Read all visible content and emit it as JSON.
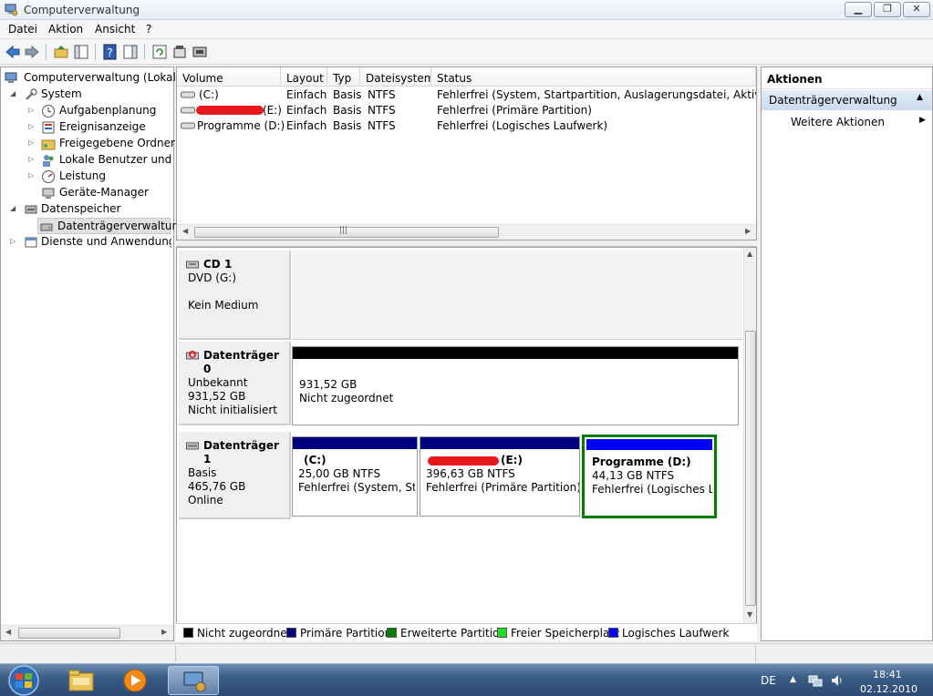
{
  "window": {
    "title": "Computerverwaltung",
    "minimize": "▁",
    "maximize": "❐",
    "close": "✕"
  },
  "menu": [
    "Datei",
    "Aktion",
    "Ansicht",
    "?"
  ],
  "tree": {
    "root": "Computerverwaltung (Lokal)",
    "system": "System",
    "aufgaben": "Aufgabenplanung",
    "ereignis": "Ereignisanzeige",
    "ordner": "Freigegebene Ordner",
    "benutzer": "Lokale Benutzer und Gr",
    "leistung": "Leistung",
    "geraete": "Geräte-Manager",
    "datenspeicher": "Datenspeicher",
    "datentraeger": "Datenträgerverwaltung",
    "dienste": "Dienste und Anwendungen"
  },
  "volumes": {
    "columns": [
      "Volume",
      "Layout",
      "Typ",
      "Dateisystem",
      "Status"
    ],
    "rows": [
      {
        "volume": "(C:)",
        "layout": "Einfach",
        "typ": "Basis",
        "fs": "NTFS",
        "status": "Fehlerfrei (System, Startpartition, Auslagerungsdatei, Aktiv, Absturz"
      },
      {
        "volume": "(E:)",
        "layout": "Einfach",
        "typ": "Basis",
        "fs": "NTFS",
        "status": "Fehlerfrei (Primäre Partition)"
      },
      {
        "volume": "Programme (D:)",
        "layout": "Einfach",
        "typ": "Basis",
        "fs": "NTFS",
        "status": "Fehlerfrei (Logisches Laufwerk)"
      }
    ],
    "scroll_glyph": "|||"
  },
  "disks": {
    "cd": {
      "name": "CD 1",
      "type": "DVD (G:)",
      "state": "Kein Medium"
    },
    "disk0": {
      "name": "Datenträger 0",
      "type": "Unbekannt",
      "size": "931,52 GB",
      "state": "Nicht initialisiert",
      "part_size": "931,52 GB",
      "part_state": "Nicht zugeordnet"
    },
    "disk1": {
      "name": "Datenträger 1",
      "type": "Basis",
      "size": "465,76 GB",
      "state": "Online",
      "parts": [
        {
          "label": "(C:)",
          "size": "25,00 GB NTFS",
          "status": "Fehlerfrei (System, Start"
        },
        {
          "label": "(E:)",
          "size": "396,63 GB NTFS",
          "status": "Fehlerfrei (Primäre Partition)"
        },
        {
          "label": "Programme  (D:)",
          "size": "44,13 GB NTFS",
          "status": "Fehlerfrei (Logisches La"
        }
      ]
    }
  },
  "legend": [
    {
      "label": "Nicht zugeordnet",
      "color": "#000000"
    },
    {
      "label": "Primäre Partition",
      "color": "#00007f"
    },
    {
      "label": "Erweiterte Partition",
      "color": "#007f00"
    },
    {
      "label": "Freier Speicherplatz",
      "color": "#22dd22"
    },
    {
      "label": "Logisches Laufwerk",
      "color": "#0000ff"
    }
  ],
  "actions": {
    "title": "Aktionen",
    "section": "Datenträgerverwaltung",
    "more": "Weitere Aktionen"
  },
  "taskbar": {
    "lang": "DE",
    "time": "18:41",
    "date": "02.12.2010"
  }
}
